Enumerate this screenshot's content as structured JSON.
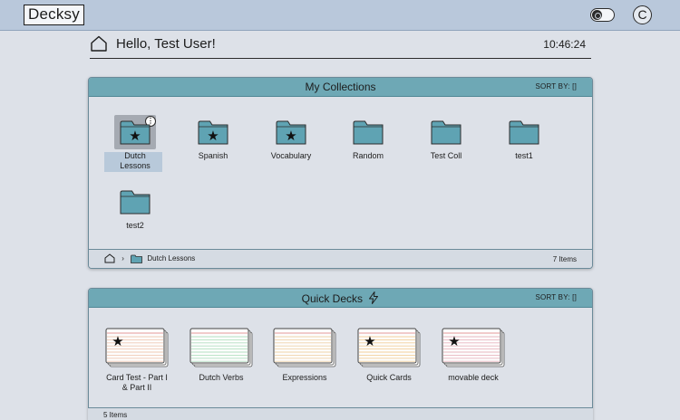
{
  "app": {
    "logo": "Decksy",
    "avatar_initial": "C"
  },
  "header": {
    "greeting": "Hello, Test User!",
    "time": "10:46:24"
  },
  "collections": {
    "title": "My Collections",
    "sort_label": "SORT BY: []",
    "items": [
      {
        "label": "Dutch Lessons",
        "starred": true,
        "selected": true
      },
      {
        "label": "Spanish",
        "starred": true
      },
      {
        "label": "Vocabulary",
        "starred": true
      },
      {
        "label": "Random",
        "starred": false
      },
      {
        "label": "Test Coll",
        "starred": false
      },
      {
        "label": "test1",
        "starred": false
      },
      {
        "label": "test2",
        "starred": false
      }
    ],
    "breadcrumb": {
      "current": "Dutch Lessons"
    },
    "count_label": "7 Items"
  },
  "quick_decks": {
    "title": "Quick Decks",
    "sort_label": "SORT BY: []",
    "decks": [
      {
        "label": "Card Test - Part I & Part II",
        "starred": true,
        "tint": "#f0c9b4"
      },
      {
        "label": "Dutch Verbs",
        "starred": false,
        "tint": "#b3e0c1"
      },
      {
        "label": "Expressions",
        "starred": false,
        "tint": "#f0d3a9"
      },
      {
        "label": "Quick Cards",
        "starred": true,
        "tint": "#f2cf9a"
      },
      {
        "label": "movable deck",
        "starred": true,
        "tint": "#e8b6bf"
      }
    ],
    "count_label": "5 Items"
  },
  "colors": {
    "accent": "#6ea8b5",
    "folder": "#5fa3b3",
    "background": "#dde1e8",
    "topbar": "#b9c8db"
  },
  "icons": [
    "home-icon",
    "theme-toggle-icon",
    "more-options-icon",
    "star-icon",
    "folder-icon",
    "lightning-icon",
    "chevron-right-icon"
  ]
}
